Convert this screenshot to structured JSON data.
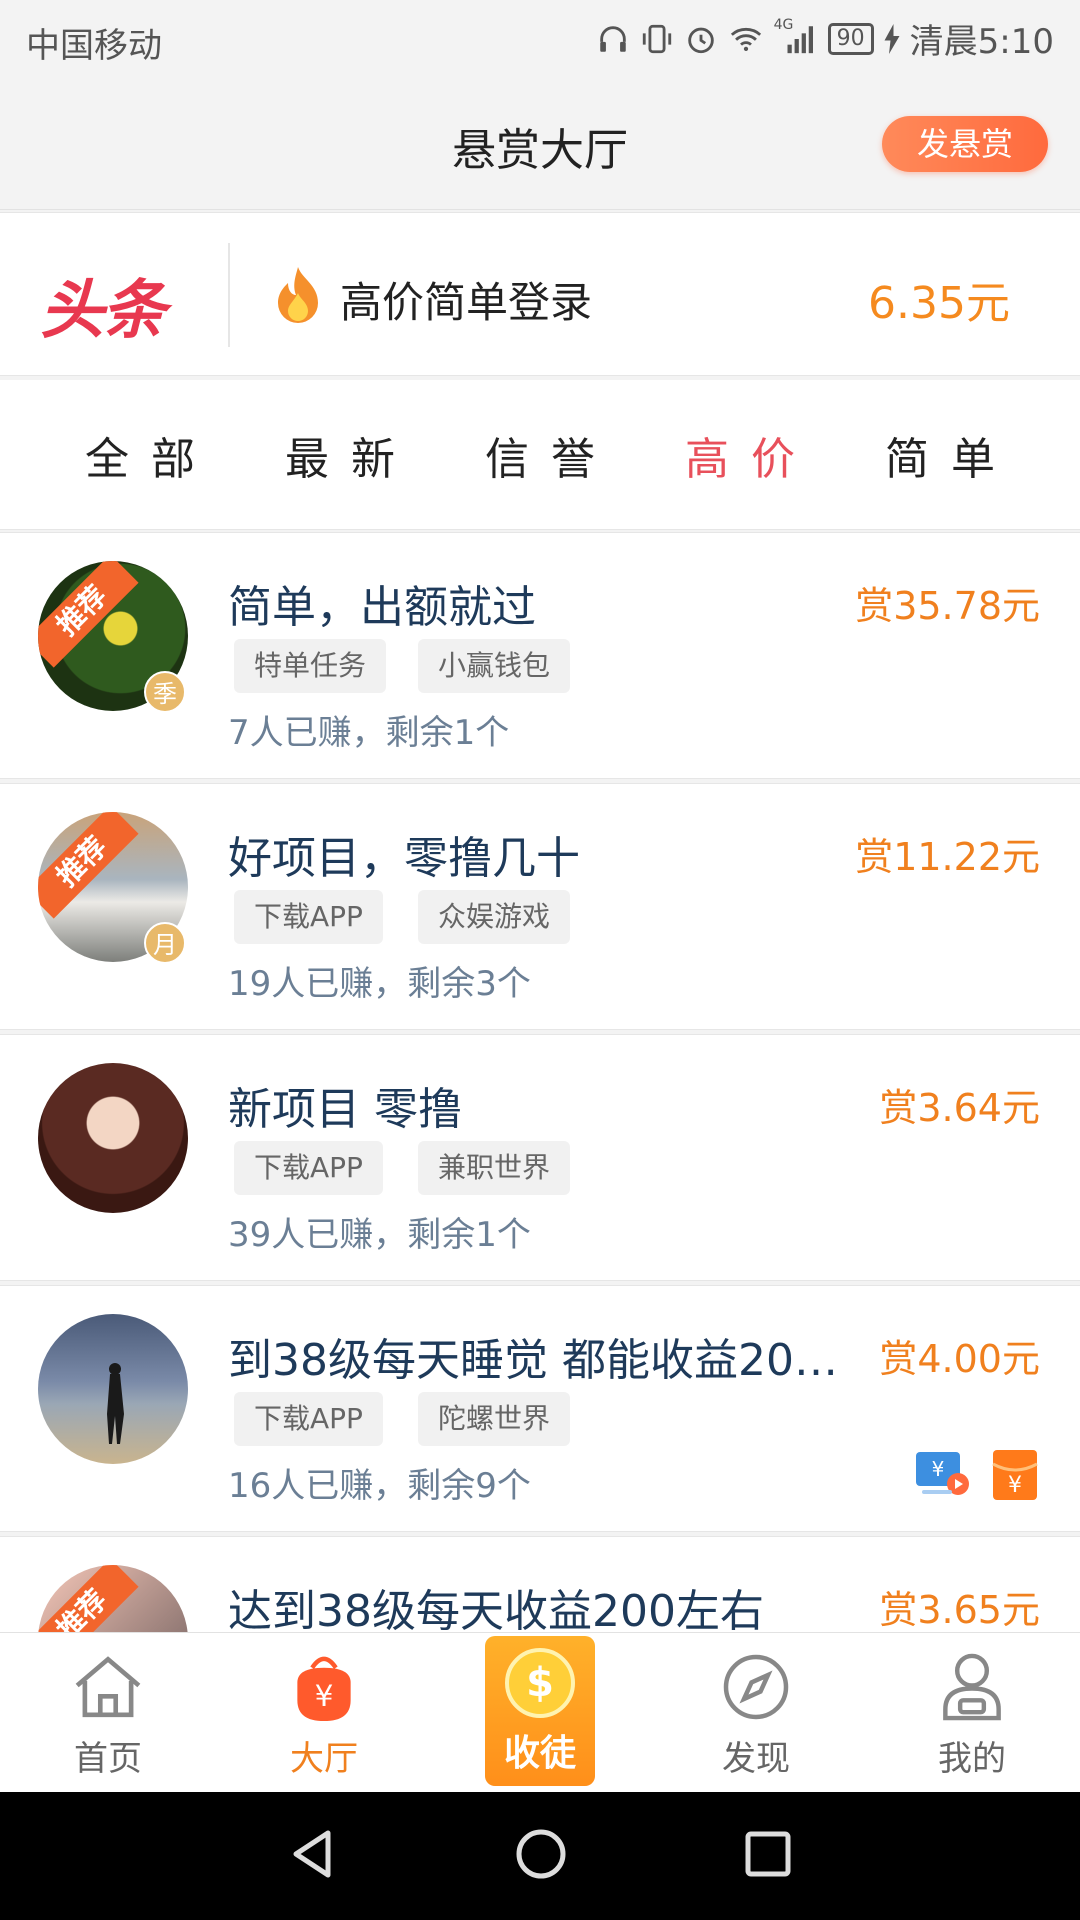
{
  "status_bar": {
    "carrier": "中国移动",
    "network": "4G",
    "battery": "90",
    "time": "清晨5:10"
  },
  "header": {
    "title": "悬赏大厅",
    "publish_label": "发悬赏"
  },
  "headline": {
    "logo_text": "头条",
    "text": "高价简单登录",
    "amount": "6.35元"
  },
  "filter_tabs": [
    "全部",
    "最新",
    "信誉",
    "高价",
    "简单"
  ],
  "active_tab": "高价",
  "tasks": [
    {
      "title": "简单，出额就过",
      "reward": "赏35.78元",
      "tags": [
        "特单任务",
        "小赢钱包"
      ],
      "stats": "7人已赚，剩余1个",
      "recommended": true,
      "ribbon": "推荐",
      "badge": "季"
    },
    {
      "title": "好项目，零撸几十",
      "reward": "赏11.22元",
      "tags": [
        "下载APP",
        "众娱游戏"
      ],
      "stats": "19人已赚，剩余3个",
      "recommended": true,
      "ribbon": "推荐",
      "badge": "月"
    },
    {
      "title": "新项目 零撸",
      "reward": "赏3.64元",
      "tags": [
        "下载APP",
        "兼职世界"
      ],
      "stats": "39人已赚，剩余1个",
      "recommended": false
    },
    {
      "title": "到38级每天睡觉 都能收益200...",
      "reward": "赏4.00元",
      "tags": [
        "下载APP",
        "陀螺世界"
      ],
      "stats": "16人已赚，剩余9个",
      "recommended": false,
      "extra_icons": [
        "video-reward-icon",
        "red-packet-icon"
      ]
    },
    {
      "title": "达到38级每天收益200左右",
      "reward": "赏3.65元",
      "recommended": true,
      "ribbon": "推荐"
    }
  ],
  "tab_bar": [
    {
      "label": "首页",
      "icon": "home-icon"
    },
    {
      "label": "大厅",
      "icon": "hall-bag-icon"
    },
    {
      "label": "收徒",
      "icon": "coin-icon"
    },
    {
      "label": "发现",
      "icon": "compass-icon"
    },
    {
      "label": "我的",
      "icon": "user-icon"
    }
  ],
  "colors": {
    "accent_orange": "#f0801e",
    "active_tab_red": "#e8505b",
    "title_navy": "#1e3a5a",
    "logo_red": "#e8384f"
  }
}
